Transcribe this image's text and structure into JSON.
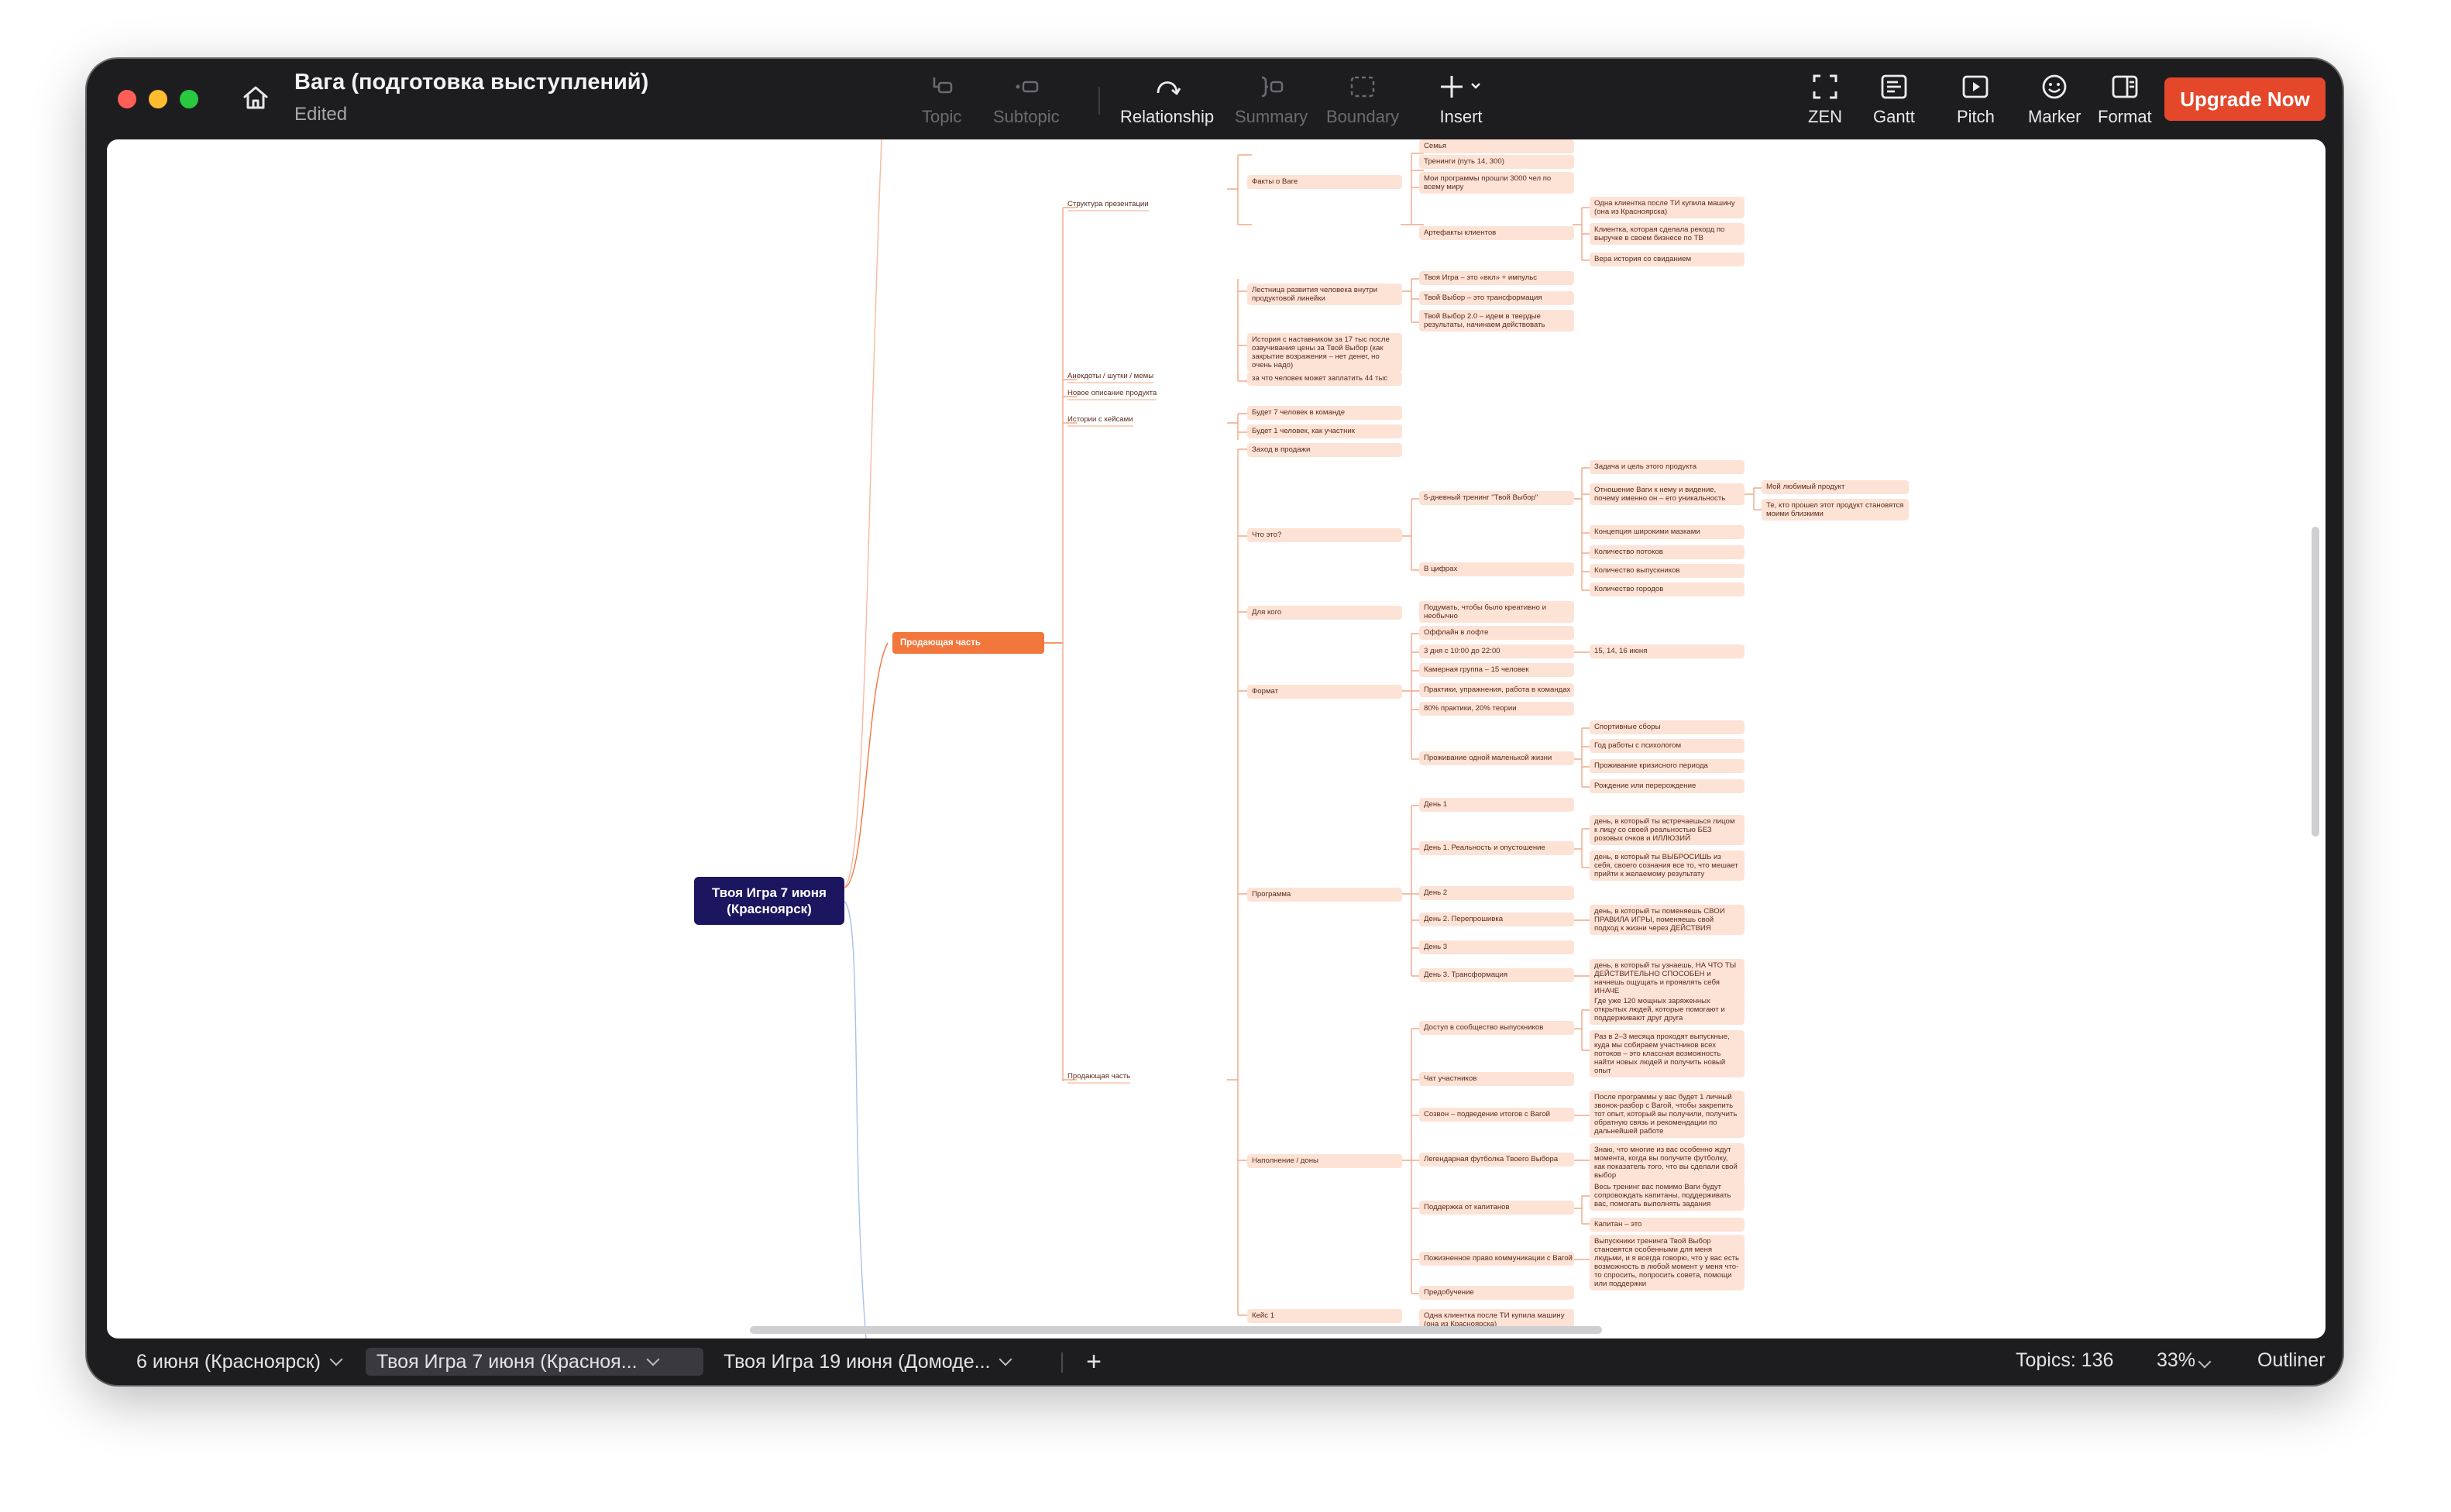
{
  "window": {
    "title": "Вага (подготовка выступлений)",
    "status": "Edited"
  },
  "toolbar": {
    "topic": "Topic",
    "subtopic": "Subtopic",
    "relationship": "Relationship",
    "summary": "Summary",
    "boundary": "Boundary",
    "insert": "Insert",
    "zen": "ZEN",
    "gantt": "Gantt",
    "pitch": "Pitch",
    "marker": "Marker",
    "format": "Format",
    "upgrade": "Upgrade Now"
  },
  "map": {
    "central": "Твоя Игра 7 июня (Красноярск)",
    "main_branch": "Продающая часть",
    "l1": {
      "structure": "Структура презентации",
      "anecdotes": "Анекдоты / шутки / мемы",
      "new_desc": "Новое описание продукта",
      "stories": "Истории с кейсами",
      "selling": "Продающая часть"
    },
    "l2": {
      "facts": "Факты о Ваге",
      "ladder": "Лестница развития человека внутри продуктовой линейки",
      "mentor_story": "История с наставником за 17 тыс после озвучивания цены за Твой Выбор (как закрытие возражения – нет денег, но очень надо)",
      "earn_44": "за что человек может заплатить 44 тыс",
      "team7": "Будет 7 человек в команде",
      "one_participant": "Будет 1 человек, как участник",
      "sales_entry": "Заход в продажи",
      "what": "Что это?",
      "for_whom": "Для кого",
      "format": "Формат",
      "program": "Программа",
      "filling": "Наполнение / доны",
      "case1": "Кейс 1"
    },
    "l3": {
      "family": "Семья",
      "trainings": "Тренинги (путь 14, 300)",
      "programs": "Мои программы прошли 3000 чел по всему миру",
      "artifacts": "Артефакты клиентов",
      "game": "Твоя Игра – это «вкл» + импульс",
      "choice": "Твой Выбор – это трансформация",
      "choice2": "Твой Выбор 2.0 – идем в твердые результаты, начинаем действовать",
      "training5": "5-дневный тренинг \"Твой Выбор\"",
      "numbers": "В цифрах",
      "creative": "Подумать, чтобы было креативно и необычно",
      "loft": "Оффлайн в лофте",
      "days3": "3 дня с 10:00 до 22:00",
      "chamber": "Камерная группа – 15 человек",
      "practices": "Практики, упражнения, работа в командах",
      "ratio": "80% практики, 20% теории",
      "live": "Проживание одной маленькой жизни",
      "day1": "День 1",
      "day1b": "День 1. Реальность и опустошение",
      "day2": "День 2",
      "day2b": "День 2. Перепрошивка",
      "day3": "День 3",
      "day3b": "День 3. Трансформация",
      "community": "Доступ в сообщество выпускников",
      "chat": "Чат участников",
      "call": "Созвон – подведение итогов с Вагой",
      "tshirt": "Легендарная футболка Твоего Выбора",
      "captains": "Поддержка от капитанов",
      "right": "Пожизненное право коммуникации с Вагой",
      "gift": "Предобучение",
      "client_car": "Одна клиентка после ТИ купила машину (она из Красноярска)"
    },
    "l4": {
      "a1": "Одна клиентка после ТИ купила машину (она из Красноярска)",
      "a2": "Клиентка, которая сделала рекорд по выручке в своем бизнесе по ТВ",
      "a3": "Вера история со свиданием",
      "task": "Задача и цель этого продукта",
      "relation": "Отношение Ваги к нему и видение, почему именно он – его уникальность",
      "concept": "Концепция широкими мазками",
      "streams": "Количество потоков",
      "grads": "Количество выпускников",
      "cities": "Количество городов",
      "dates": "15, 14, 16 июня",
      "sport": "Спортивные сборы",
      "psych": "Год работы с психологом",
      "crisis": "Проживание кризисного периода",
      "birth": "Рождение или перерождение",
      "d1a": "день, в который ты встречаешься лицом к лицу со своей реальностью БЕЗ розовых очков и ИЛЛЮЗИЙ",
      "d1b": "день, в который ты ВЫБРОСИШЬ из себя, своего сознания все то, что мешает прийти к желаемому результату",
      "d2a": "день, в который ты поменяешь СВОИ ПРАВИЛА ИГРЫ, поменяешь свой подход к жизни через ДЕЙСТВИЯ",
      "d3a": "день, в который ты узнаешь, НА ЧТО ТЫ ДЕЙСТВИТЕЛЬНО СПОСОБЕН и начнешь ощущать и проявлять себя ИНАЧЕ",
      "c1": "Где уже 120 мощных заряженных открытых людей, которые помогают и поддерживают друг друга",
      "c2": "Раз в 2–3 месяца проходят выпускные, куда мы собираем участников всех потоков – это классная возможность найти новых людей и получить новый опыт",
      "call_d": "После программы у вас будет 1 личный звонок-разбор с Вагой, чтобы закрепить тот опыт, который вы получили, получить обратную связь и рекомендации по дальнейшей работе",
      "shirt_d": "Знаю, что многие из вас особенно ждут момента, когда вы получите футболку, как показатель того, что вы сделали свой выбор",
      "cap_d": "Весь тренинг вас помимо Ваги будут сопровождать капитаны, поддерживать вас, помогать выполнять задания",
      "cap2": "Капитан – это",
      "right_d": "Выпускники тренинга Твой Выбор становятся особенными для меня людьми, и я всегда говорю, что у вас есть возможность в любой момент у меня что-то спросить, попросить совета, помощи или поддержки",
      "fav": "Мой любимый продукт",
      "close": "Те, кто прошел этот продукт становятся моими близкими"
    }
  },
  "bottom": {
    "tabs": [
      "6 июня (Красноярск)",
      "Твоя Игра 7 июня (Красноя...",
      "Твоя Игра 19 июня (Домоде..."
    ],
    "topics": "Topics: 136",
    "zoom": "33%",
    "outliner": "Outliner"
  }
}
